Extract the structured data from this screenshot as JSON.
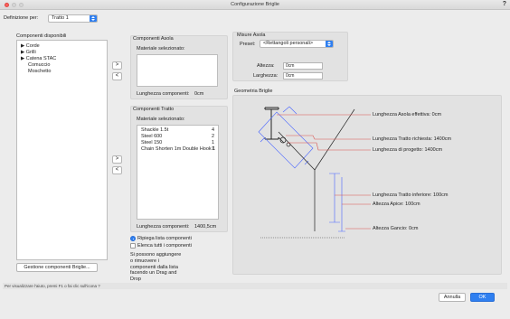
{
  "window": {
    "title": "Configurazione Briglie",
    "help": "?"
  },
  "definition": {
    "label": "Definizione per:",
    "value": "Tratto 1"
  },
  "available": {
    "title": "Componenti disponibili",
    "items": [
      "▶ Corde",
      "▶ Grilli",
      "▶ Catena STAC",
      "Comuccio",
      "Moschetto"
    ],
    "manage_button": "Gestione componenti Briglie..."
  },
  "eye_components": {
    "title": "Componenti Asola",
    "selected_label": "Materiale selezionato:",
    "length_label": "Lunghezza componenti:",
    "length_value": "0cm"
  },
  "segment_components": {
    "title": "Componenti Tratto",
    "selected_label": "Materiale selezionato:",
    "items": [
      {
        "name": "Shackle 1.5t",
        "qty": "4"
      },
      {
        "name": "Steel 600",
        "qty": "2"
      },
      {
        "name": "Steel 150",
        "qty": "1"
      },
      {
        "name": "Chain Shorten 1m Double Hook 1",
        "qty": "1"
      }
    ],
    "length_label": "Lunghezza componenti:",
    "length_value": "1400,5cm"
  },
  "arrows": {
    "add": ">",
    "remove": "<"
  },
  "options": {
    "collapse": "Ripiega lista componenti",
    "list_all": "Elenca tutti i componenti",
    "hint": "Si possono aggiungere o rimuovere i componenti dalla lista facendo un Drag and Drop"
  },
  "eye_measures": {
    "title": "Misure Asola",
    "preset_label": "Preset:",
    "preset_value": "<Rettangoli personali>",
    "height_label": "Altezza:",
    "height_value": "0cm",
    "width_label": "Larghezza:",
    "width_value": "0cm"
  },
  "geometry": {
    "title": "Geometria Briglie",
    "labels": {
      "eye_length": "Lunghezza Asola effettiva: 0cm",
      "required_length": "Lunghezza Tratto richiesta: 1400cm",
      "design_length": "Lunghezza di progetto: 1400cm",
      "lower_length": "Lunghezza Tratto inferiore: 100cm",
      "apex_height": "Altezza Apice: 100cm",
      "hook_height": "Altezza Gancio: 0cm"
    },
    "colors": {
      "callout": "#d9534f",
      "guide": "#4a66ff",
      "line": "#222222"
    }
  },
  "status": "Per visualizzare l'aiuto, premi F1 o fai clic sull'icona ?",
  "footer": {
    "cancel": "Annulla",
    "ok": "OK"
  },
  "accent": "#2f7ff0"
}
